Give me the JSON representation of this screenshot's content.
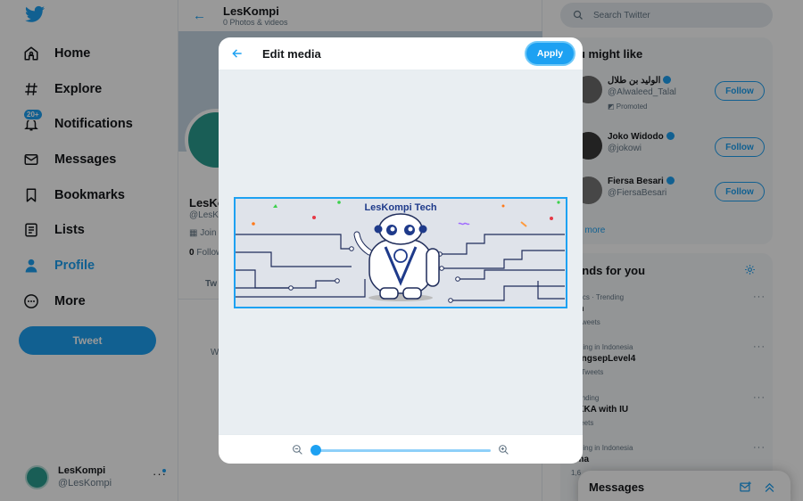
{
  "sidebar": {
    "items": [
      {
        "label": "Home",
        "icon": "home-icon"
      },
      {
        "label": "Explore",
        "icon": "hashtag-icon"
      },
      {
        "label": "Notifications",
        "icon": "bell-icon",
        "badge": "20+"
      },
      {
        "label": "Messages",
        "icon": "mail-icon"
      },
      {
        "label": "Bookmarks",
        "icon": "bookmark-icon"
      },
      {
        "label": "Lists",
        "icon": "list-icon"
      },
      {
        "label": "Profile",
        "icon": "user-icon",
        "active": true
      },
      {
        "label": "More",
        "icon": "more-icon"
      }
    ],
    "tweet_label": "Tweet",
    "account": {
      "name": "LesKompi",
      "handle": "@LesKompi"
    }
  },
  "main": {
    "title": "LesKompi",
    "subtitle": "0 Photos & videos",
    "profile_name": "LesKo",
    "profile_handle": "@LesK",
    "joined": "Join",
    "following_count": "0",
    "following_label": "Follow",
    "tab_label": "Tw",
    "empty_text": "W"
  },
  "search": {
    "placeholder": "Search Twitter"
  },
  "who_to_follow": {
    "title": "ou might like",
    "users": [
      {
        "name": "الوليد بن طلال",
        "handle": "@Alwaleed_Talal",
        "promoted": "Promoted"
      },
      {
        "name": "Joko Widodo",
        "handle": "@jokowi"
      },
      {
        "name": "Fiersa Besari",
        "handle": "@FiersaBesari"
      }
    ],
    "follow_label": "Follow",
    "show_more": "ow more"
  },
  "trends": {
    "title": "rends for you",
    "items": [
      {
        "meta": "mpics · Trending",
        "name": "vin",
        "count": "K Tweets"
      },
      {
        "meta": "ending in Indonesia",
        "name": "yungsepLevel4",
        "count": "19 Tweets"
      },
      {
        "meta": "Trending",
        "name": "AKKA with IU",
        "count": "Tweets"
      },
      {
        "meta": "ending in Indonesia",
        "name": "sma",
        "count": "1,6"
      }
    ]
  },
  "messages_drawer": {
    "title": "Messages"
  },
  "modal": {
    "title": "Edit media",
    "apply_label": "Apply",
    "banner_title": "LesKompi Tech",
    "zoom_level": 0.0
  },
  "colors": {
    "accent": "#1da1f2",
    "text": "#14171a",
    "muted": "#657786",
    "banner_text": "#1e3a8a"
  }
}
